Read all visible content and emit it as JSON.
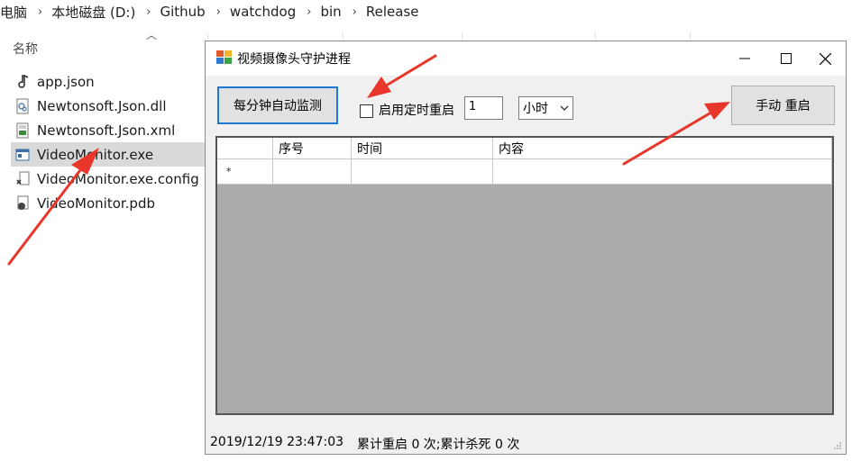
{
  "explorer": {
    "breadcrumb": [
      "电脑",
      "本地磁盘 (D:)",
      "Github",
      "watchdog",
      "bin",
      "Release"
    ],
    "column_name": "名称",
    "files": [
      {
        "name": "app.json",
        "icon": "json-file-icon"
      },
      {
        "name": "Newtonsoft.Json.dll",
        "icon": "dll-file-icon"
      },
      {
        "name": "Newtonsoft.Json.xml",
        "icon": "xml-file-icon"
      },
      {
        "name": "VideoMonitor.exe",
        "icon": "exe-file-icon",
        "selected": true
      },
      {
        "name": "VideoMonitor.exe.config",
        "icon": "config-file-icon"
      },
      {
        "name": "VideoMonitor.pdb",
        "icon": "pdb-file-icon"
      }
    ]
  },
  "window": {
    "title": "视频摄像头守护进程",
    "auto_monitor_button": "每分钟自动监测",
    "timer_checkbox_label": "启用定时重启",
    "timer_checked": false,
    "interval_value": "1",
    "unit_selected": "小时",
    "manual_restart_button": "手动 重启",
    "grid": {
      "columns": [
        "",
        "序号",
        "时间",
        "内容"
      ],
      "new_row_marker": "*"
    },
    "status": {
      "time": "2019/12/19 23:47:03",
      "counts": "累计重启 0 次;累计杀死 0 次"
    }
  },
  "colors": {
    "annotation_arrow": "#e8372a",
    "focus_border": "#1e78d4",
    "grid_background": "#ababab",
    "selected_row": "#d9d9d9"
  }
}
